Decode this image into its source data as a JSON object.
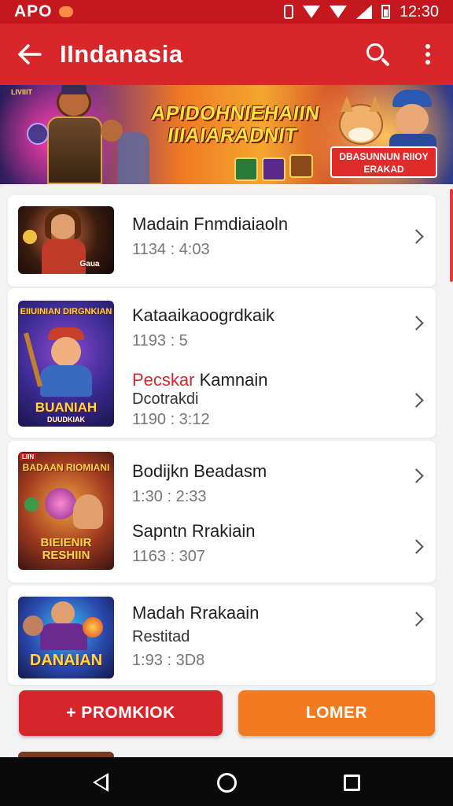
{
  "status_bar": {
    "left_text": "APO",
    "time": "12:30"
  },
  "app_bar": {
    "title": "IIndanasia"
  },
  "banner": {
    "title": "APIDOHNIEHAIIN IIIAIARADNIT",
    "corner_label": "LIVIIIT",
    "badge": "DBASUNNUN RIIOY ERAKAD"
  },
  "list": [
    {
      "title": "Madain Fnmdiaiaoln",
      "meta": "1134 : 4:03",
      "thumb_caption": "Gaua"
    },
    {
      "title": "Kataaikaoogrdkaik",
      "meta": "1193 : 5",
      "thumb_caption_top": "EIIUINIAN DIRGNKIAN",
      "thumb_caption": "BUANIAH",
      "thumb_sub": "DUUDKIAK"
    },
    {
      "title_red": "Pecskar",
      "title": "Kamnain",
      "subtitle": "Dcotrakdi",
      "meta": "1190 : 3:12"
    },
    {
      "title": "Bodijkn Beadasm",
      "meta": "1:30 : 2:33",
      "thumb_caption_top": "BADAAN RIOMIANI",
      "thumb_caption": "BIEIENIR RESHIIN",
      "thumb_corner": "LIIN"
    },
    {
      "title": "Sapntn Rrakiain",
      "meta": "1163 : 307"
    },
    {
      "title": "Madah Rrakaain",
      "subtitle": "Restitad",
      "meta": "1:93 : 3D8",
      "thumb_caption": "DANAIAN"
    }
  ],
  "buttons": {
    "promo": "+ PROMKIOK",
    "more": "LOMER"
  },
  "colors": {
    "primary": "#d9262b",
    "status": "#c4181e",
    "accent_orange": "#f47a20"
  },
  "icons": [
    "back-arrow-icon",
    "search-icon",
    "more-vert-icon",
    "chevron-right-icon",
    "nav-back-icon",
    "nav-home-icon",
    "nav-recents-icon"
  ]
}
